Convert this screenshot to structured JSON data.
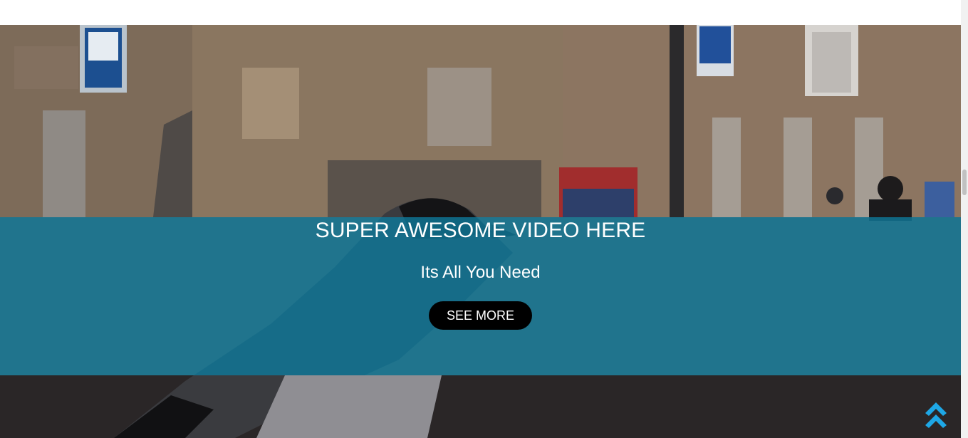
{
  "hero": {
    "title": "SUPER AWESOME VIDEO HERE",
    "subtitle": "Its All You Need",
    "cta_label": "SEE MORE",
    "overlay_color": "#0e799b"
  },
  "back_to_top": {
    "icon": "double-chevron-up-icon",
    "color": "#1ea7e6"
  }
}
